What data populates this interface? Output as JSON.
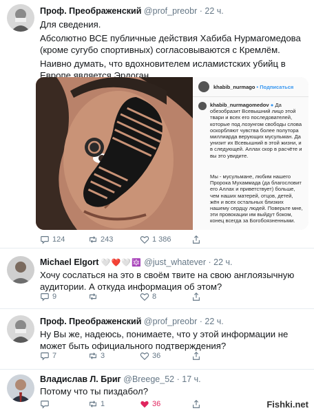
{
  "tweets": [
    {
      "name": "Проф. Преображенский",
      "handle": "@prof_preobr",
      "time": "· 22 ч.",
      "lines": [
        "Для сведения.",
        "Абсолютно ВСЕ публичные действия Хабиба Нурмагомедова (кроме сугубо спортивных) согласовываются с Кремлём.",
        "Наивно думать, что вдохновителем исламистских убийц в Европе является Эрдоган."
      ],
      "replies": "124",
      "retweets": "243",
      "likes": "1 386"
    },
    {
      "name": "Michael Elgort",
      "hearts": "🤍❤️🤍🔯",
      "handle": "@just_whatever",
      "time": "· 22 ч.",
      "lines": [
        "Хочу сослаться на это в своём твите на свою англоязычную аудитории. А откуда информация об этом?"
      ],
      "replies": "9",
      "retweets": "",
      "likes": "8"
    },
    {
      "name": "Проф. Преображенский",
      "handle": "@prof_preobr",
      "time": "· 22 ч.",
      "lines": [
        "Ну Вы же, надеюсь, понимаете, что у этой информации не может быть официального подтверждения?"
      ],
      "replies": "7",
      "retweets": "3",
      "likes": "36"
    },
    {
      "name": "Владислав Л. Бриг",
      "handle": "@Breege_52",
      "time": "· 17 ч.",
      "lines": [
        "Потому что ты пиздабол?"
      ],
      "replies": "",
      "retweets": "1",
      "likes": "36"
    }
  ],
  "instagram": {
    "username": "khabib_nurmago",
    "follow": "• Подписаться",
    "caption_user": "khabib_nurmagomedov",
    "caption": "Да обезобразит Всевышний лицо этой твари и всех его последователей, которые под лозунгом свободы слова оскорбляют чувства более полутора миллиарда верующих мусульман. Да унизит их Всевышний в этой жизни, и в следующей. Аллах скор в расчёте и вы это увидите.",
    "caption2": "Мы - мусульмане, любим нашего Пророка Мухаммада (да благословит его Аллах и приветствует) больше, чем наших матерей, отцов, детей, жён и всех остальных близких нашему сердцу людей. Поверьте мне, эти провокации им выйдут боком, конец всегда за Богобоязненными."
  },
  "watermark": "Fishki.net",
  "colors": {
    "muted": "#657786",
    "like_red": "#e0245e",
    "verified_blue": "#3897f0"
  }
}
